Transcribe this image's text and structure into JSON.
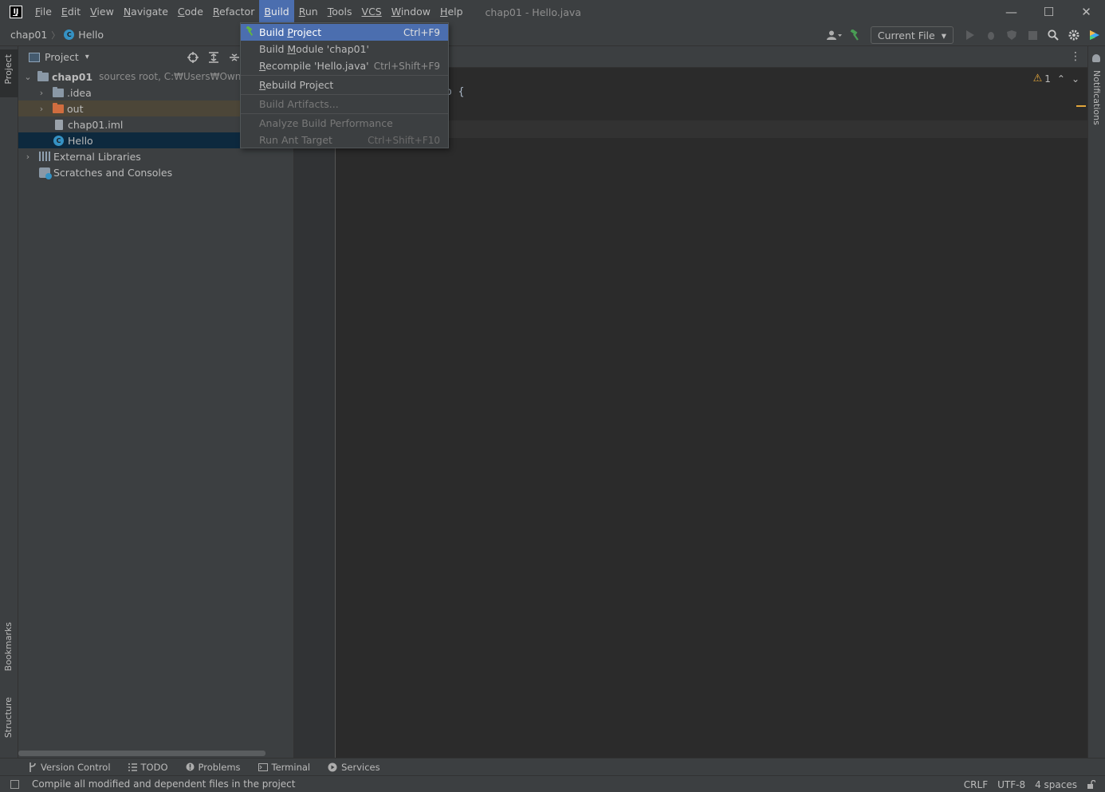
{
  "app": {
    "logo_text": "IJ",
    "window_title": "chap01 - Hello.java"
  },
  "menu": [
    {
      "mnemonic": "F",
      "rest": "ile"
    },
    {
      "mnemonic": "E",
      "rest": "dit"
    },
    {
      "mnemonic": "V",
      "rest": "iew"
    },
    {
      "mnemonic": "N",
      "rest": "avigate"
    },
    {
      "mnemonic": "C",
      "rest": "ode"
    },
    {
      "mnemonic": "R",
      "rest": "efactor"
    },
    {
      "mnemonic": "B",
      "rest": "uild"
    },
    {
      "mnemonic": "R",
      "rest": "un"
    },
    {
      "mnemonic": "T",
      "rest": "ools"
    },
    {
      "mnemonic": "VCS",
      "rest": ""
    },
    {
      "mnemonic": "W",
      "rest": "indow"
    },
    {
      "mnemonic": "H",
      "rest": "elp"
    }
  ],
  "window_controls": {
    "minimize": "—",
    "maximize": "☐",
    "close": "✕"
  },
  "breadcrumb": {
    "root": "chap01",
    "separator": "〉",
    "leaf_icon": "C",
    "leaf": "Hello"
  },
  "toolbar": {
    "account_icon": "person-dropdown-icon",
    "run_config": "Current File",
    "run_config_caret": "▾"
  },
  "left_strip": {
    "project": "Project",
    "bookmarks": "Bookmarks",
    "structure": "Structure"
  },
  "right_strip": {
    "notifications": "Notifications"
  },
  "project_panel": {
    "title": "Project",
    "caret": "▾",
    "tree": [
      {
        "name": "chap01",
        "detail": "sources root,  C:₩Users₩Owner₩id"
      },
      {
        "name": ".idea"
      },
      {
        "name": "out"
      },
      {
        "name": "chap01.iml"
      },
      {
        "name": "Hello",
        "icon": "C"
      },
      {
        "name": "External Libraries"
      },
      {
        "name": "Scratches and Consoles"
      }
    ]
  },
  "editor": {
    "visible_code": "o {",
    "warning_count": "1",
    "warning_symbol": "⚠",
    "prev_symbol": "⌃",
    "next_symbol": "⌄",
    "more_symbol": "⋮"
  },
  "build_menu": {
    "items": [
      {
        "label_pre": "Build ",
        "label_mn": "P",
        "label_post": "roject",
        "shortcut": "Ctrl+F9",
        "state": "selected"
      },
      {
        "label_pre": "Build ",
        "label_mn": "M",
        "label_post": "odule 'chap01'",
        "shortcut": "",
        "state": "enabled"
      },
      {
        "label_pre": "",
        "label_mn": "R",
        "label_post": "ecompile 'Hello.java'",
        "shortcut": "Ctrl+Shift+F9",
        "state": "enabled"
      },
      {
        "label_pre": "",
        "label_mn": "R",
        "label_post": "ebuild Project",
        "shortcut": "",
        "state": "enabled"
      },
      {
        "label_pre": "Build Artifacts...",
        "label_mn": "",
        "label_post": "",
        "shortcut": "",
        "state": "disabled"
      },
      {
        "label_pre": "Analyze Build Performance",
        "label_mn": "",
        "label_post": "",
        "shortcut": "",
        "state": "disabled"
      },
      {
        "label_pre": "Run Ant Target",
        "label_mn": "",
        "label_post": "",
        "shortcut": "Ctrl+Shift+F10",
        "state": "disabled"
      }
    ]
  },
  "bottom_tabs": [
    "Version Control",
    "TODO",
    "Problems",
    "Terminal",
    "Services"
  ],
  "status": {
    "message": "Compile all modified and dependent files in the project",
    "line_separator": "CRLF",
    "encoding": "UTF-8",
    "indent": "4 spaces"
  },
  "colors": {
    "accent": "#4b6eaf",
    "panel": "#3c3f41",
    "editor_bg": "#2b2b2b",
    "selection": "#0d293e",
    "excluded_folder": "#d06d3f",
    "warning": "#e2a53a",
    "build_green": "#499c54"
  }
}
